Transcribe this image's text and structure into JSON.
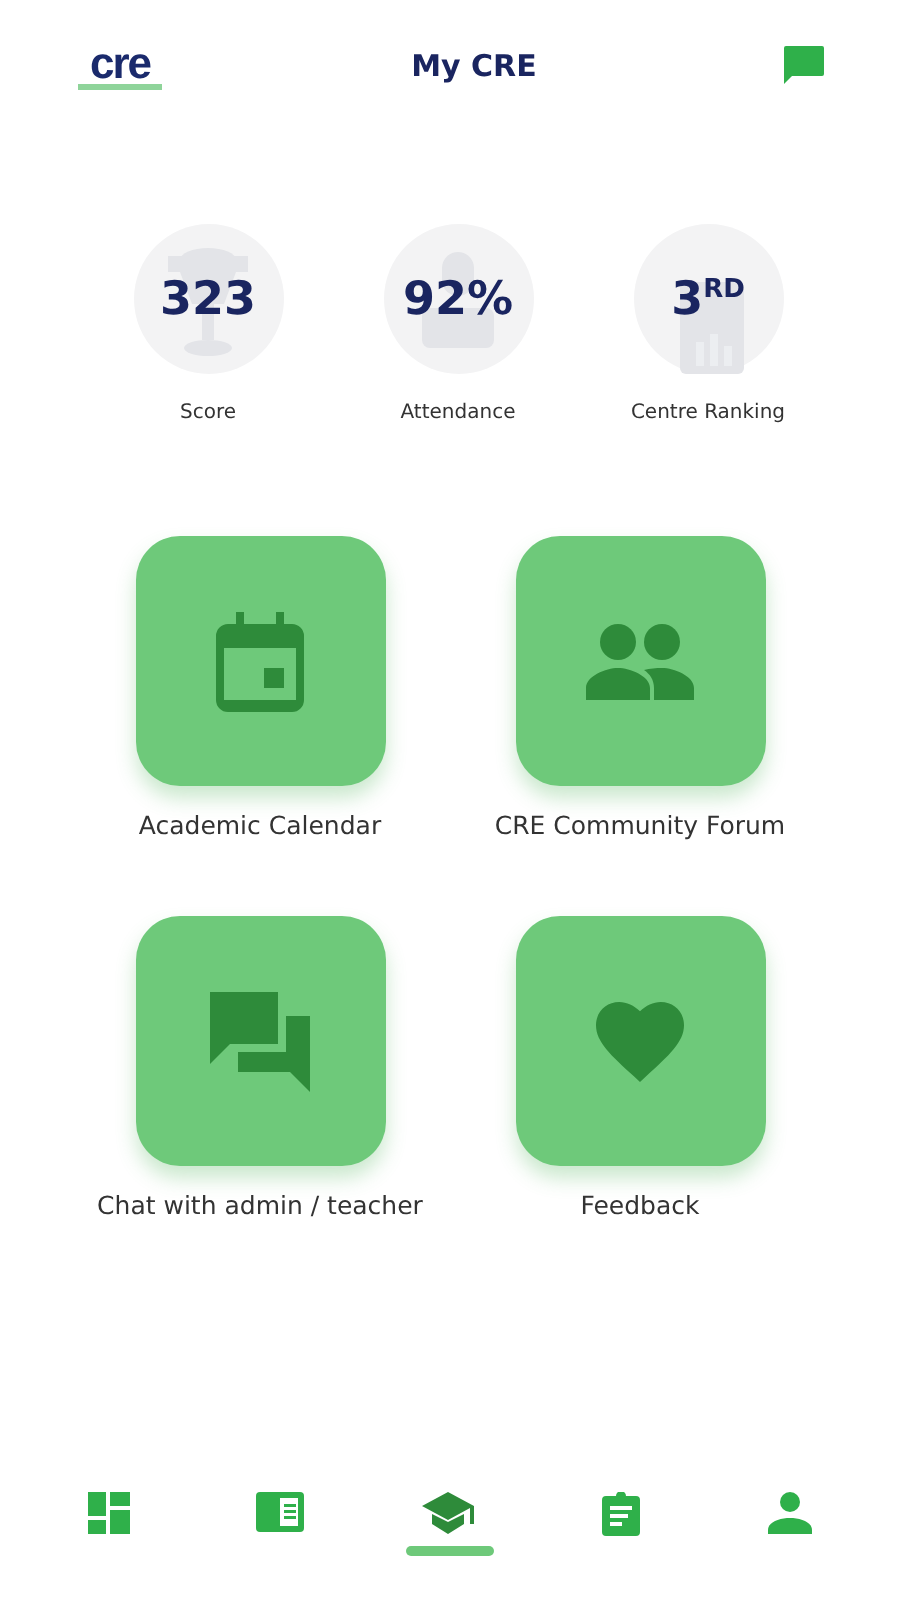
{
  "header": {
    "logo": "cre",
    "title": "My CRE"
  },
  "stats": [
    {
      "value": "323",
      "label": "Score",
      "kind": "trophy"
    },
    {
      "value": "92%",
      "label": "Attendance",
      "kind": "person"
    },
    {
      "value": "3$^{RD}$",
      "label": "Centre Ranking",
      "kind": "board"
    }
  ],
  "tiles": [
    {
      "label": "Academic Calendar",
      "kind": "calendar"
    },
    {
      "label": "CRE Community Forum",
      "kind": "people"
    },
    {
      "label": "Chat with admin / teacher",
      "kind": "chat"
    },
    {
      "label": "Feedback",
      "kind": "heart"
    }
  ],
  "nav": [
    {
      "kind": "dashboard",
      "selected": false
    },
    {
      "kind": "book",
      "selected": false
    },
    {
      "kind": "school",
      "selected": true
    },
    {
      "kind": "clipboard",
      "selected": false
    },
    {
      "kind": "person",
      "selected": false
    }
  ]
}
